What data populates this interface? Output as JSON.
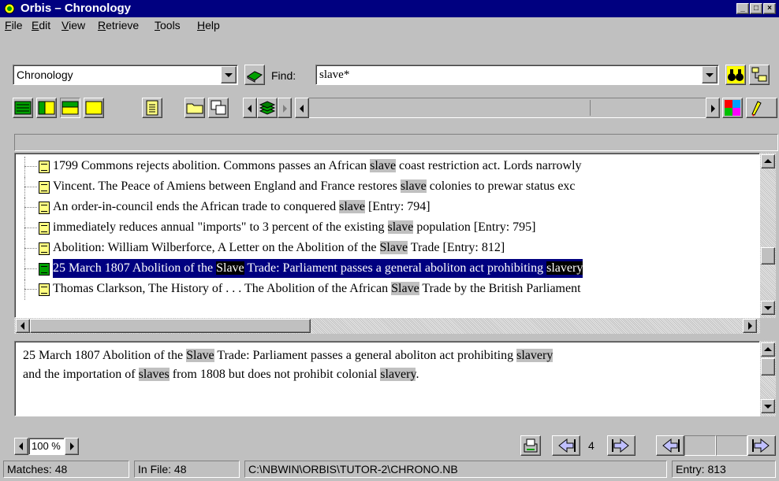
{
  "window": {
    "title": "Orbis – Chronology"
  },
  "menu": [
    {
      "label": "File"
    },
    {
      "label": "Edit"
    },
    {
      "label": "View"
    },
    {
      "label": "Retrieve"
    },
    {
      "label": "Tools"
    },
    {
      "label": "Help"
    }
  ],
  "toolbar": {
    "notebook_select": "Chronology",
    "find_label": "Find:",
    "find_value": "slave*"
  },
  "list": {
    "rows": [
      {
        "pre": "1799 Commons rejects abolition. Commons passes an African ",
        "hl": "slave",
        "post": " coast restriction act. Lords narrowly"
      },
      {
        "pre": "Vincent. The Peace of Amiens between England and France restores ",
        "hl": "slave",
        "post": " colonies to prewar status exc"
      },
      {
        "pre": "An order-in-council ends the African trade to conquered ",
        "hl": "slave",
        "post": " [Entry: 794]"
      },
      {
        "pre": "immediately reduces annual \"imports\" to 3 percent of the existing ",
        "hl": "slave",
        "post": " population [Entry: 795]"
      },
      {
        "pre": "Abolition: William Wilberforce, A Letter on the Abolition of the ",
        "hl": "Slave",
        "post": " Trade [Entry: 812]"
      },
      {
        "pre": "25 March 1807 Abolition of the ",
        "hl": "Slave",
        "post": " Trade: Parliament passes a general aboliton act prohibiting ",
        "hl2": "slavery",
        "selected": true
      },
      {
        "pre": "Thomas Clarkson, The History of . . . The Abolition of the African ",
        "hl": "Slave",
        "post": " Trade by the British Parliament"
      }
    ]
  },
  "detail": {
    "l1_a": "25 March 1807 Abolition of the ",
    "l1_hl": "Slave",
    "l1_b": " Trade: Parliament passes a general aboliton act prohibiting ",
    "l1_hl2": "slavery",
    "l2_a": "and the importation of ",
    "l2_hl": "slaves",
    "l2_b": " from 1808 but does not prohibit colonial ",
    "l2_hl2": "slavery",
    "l2_c": "."
  },
  "bottom": {
    "zoom": "100 %",
    "page_number": "4"
  },
  "status": {
    "matches": "Matches: 48",
    "in_file": "In File: 48",
    "path": "C:\\NBWIN\\ORBIS\\TUTOR-2\\CHRONO.NB",
    "entry": "Entry: 813"
  },
  "colors": {
    "titlebar": "#000080",
    "selection": "#000080",
    "highlight": "#c0c0c0",
    "face": "#c0c0c0"
  }
}
